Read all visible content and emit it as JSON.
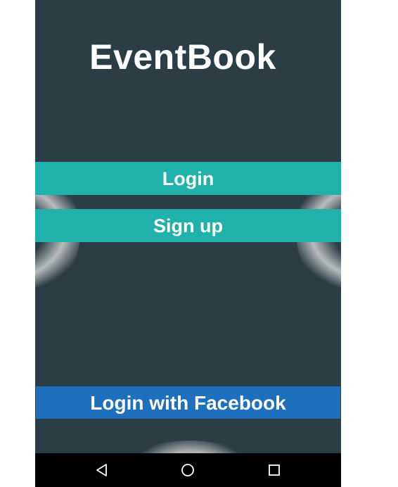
{
  "app": {
    "title": "EventBook"
  },
  "buttons": {
    "login_label": "Login",
    "signup_label": "Sign up",
    "facebook_label": "Login with Facebook"
  },
  "navbar": {
    "back_icon": "back-triangle-icon",
    "home_icon": "home-circle-icon",
    "recent_icon": "recent-apps-square-icon"
  },
  "colors": {
    "background": "#2b3d45",
    "primary_button": "#20b2aa",
    "facebook_button": "#1e70bf",
    "navbar": "#000000",
    "text": "#ffffff"
  }
}
